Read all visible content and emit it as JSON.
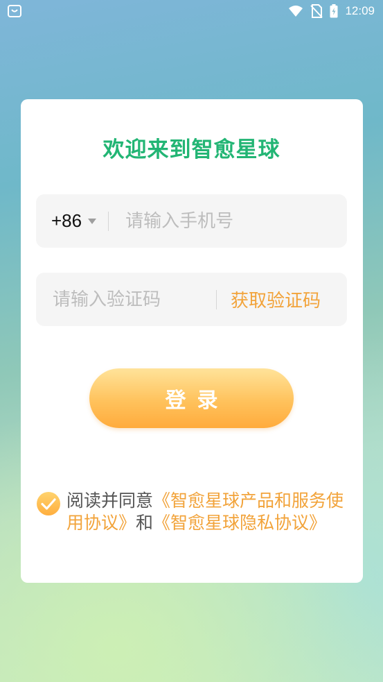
{
  "status_bar": {
    "time": "12:09",
    "icons": [
      "app-notification-icon",
      "wifi-icon",
      "no-sim-icon",
      "battery-charging-icon"
    ]
  },
  "login": {
    "title": "欢迎来到智愈星球",
    "country_code": "+86",
    "phone_placeholder": "请输入手机号",
    "code_placeholder": "请输入验证码",
    "get_code_label": "获取验证码",
    "login_button": "登录"
  },
  "agreement": {
    "checked": true,
    "prefix": "阅读并同意",
    "service_link": "《智愈星球产品和服务使用协议》",
    "conjunction": "和",
    "privacy_link": "《智愈星球隐私协议》"
  },
  "colors": {
    "title_green": "#22b574",
    "accent_orange": "#f2a33a",
    "button_gradient_top": "#ffe39a",
    "button_gradient_bottom": "#ffab3c"
  }
}
